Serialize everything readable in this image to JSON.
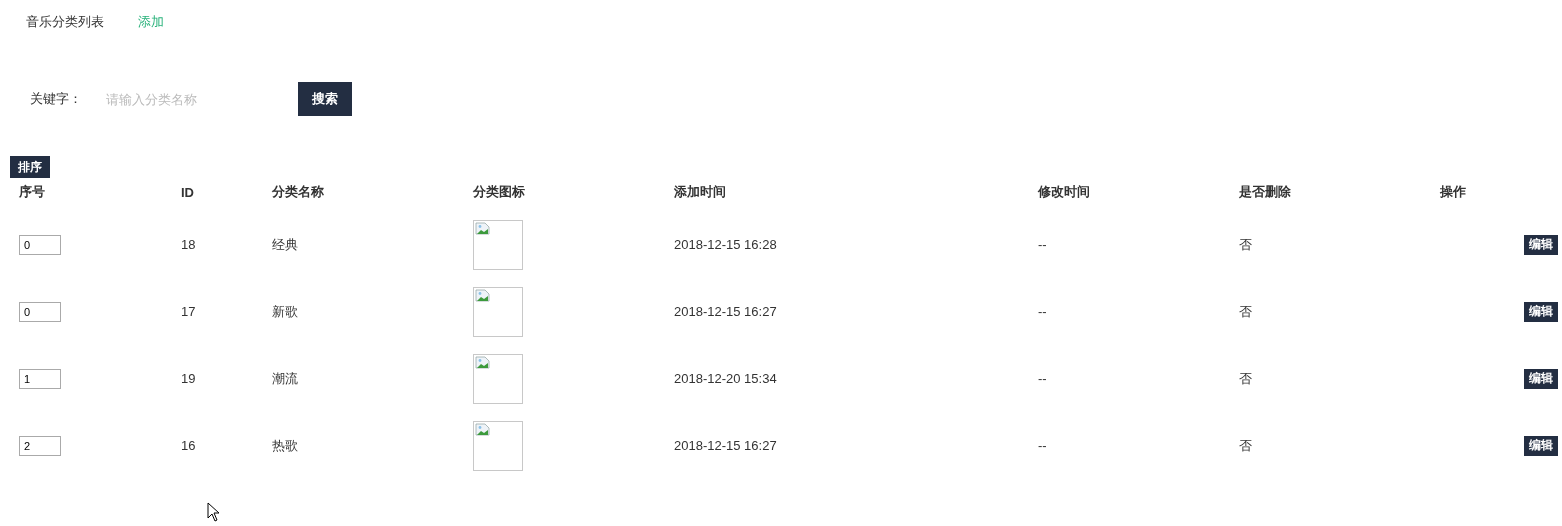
{
  "header": {
    "title": "音乐分类列表",
    "add_link": "添加"
  },
  "search": {
    "label": "关键字：",
    "placeholder": "请输入分类名称",
    "button": "搜索"
  },
  "sort_button": "排序",
  "table": {
    "columns": [
      "序号",
      "ID",
      "分类名称",
      "分类图标",
      "添加时间",
      "修改时间",
      "是否删除",
      "操作"
    ],
    "rows": [
      {
        "order": "0",
        "id": "18",
        "name": "经典",
        "added": "2018-12-15 16:28",
        "modified": "--",
        "deleted": "否",
        "action": "编辑"
      },
      {
        "order": "0",
        "id": "17",
        "name": "新歌",
        "added": "2018-12-15 16:27",
        "modified": "--",
        "deleted": "否",
        "action": "编辑"
      },
      {
        "order": "1",
        "id": "19",
        "name": "潮流",
        "added": "2018-12-20 15:34",
        "modified": "--",
        "deleted": "否",
        "action": "编辑"
      },
      {
        "order": "2",
        "id": "16",
        "name": "热歌",
        "added": "2018-12-15 16:27",
        "modified": "--",
        "deleted": "否",
        "action": "编辑"
      }
    ]
  }
}
